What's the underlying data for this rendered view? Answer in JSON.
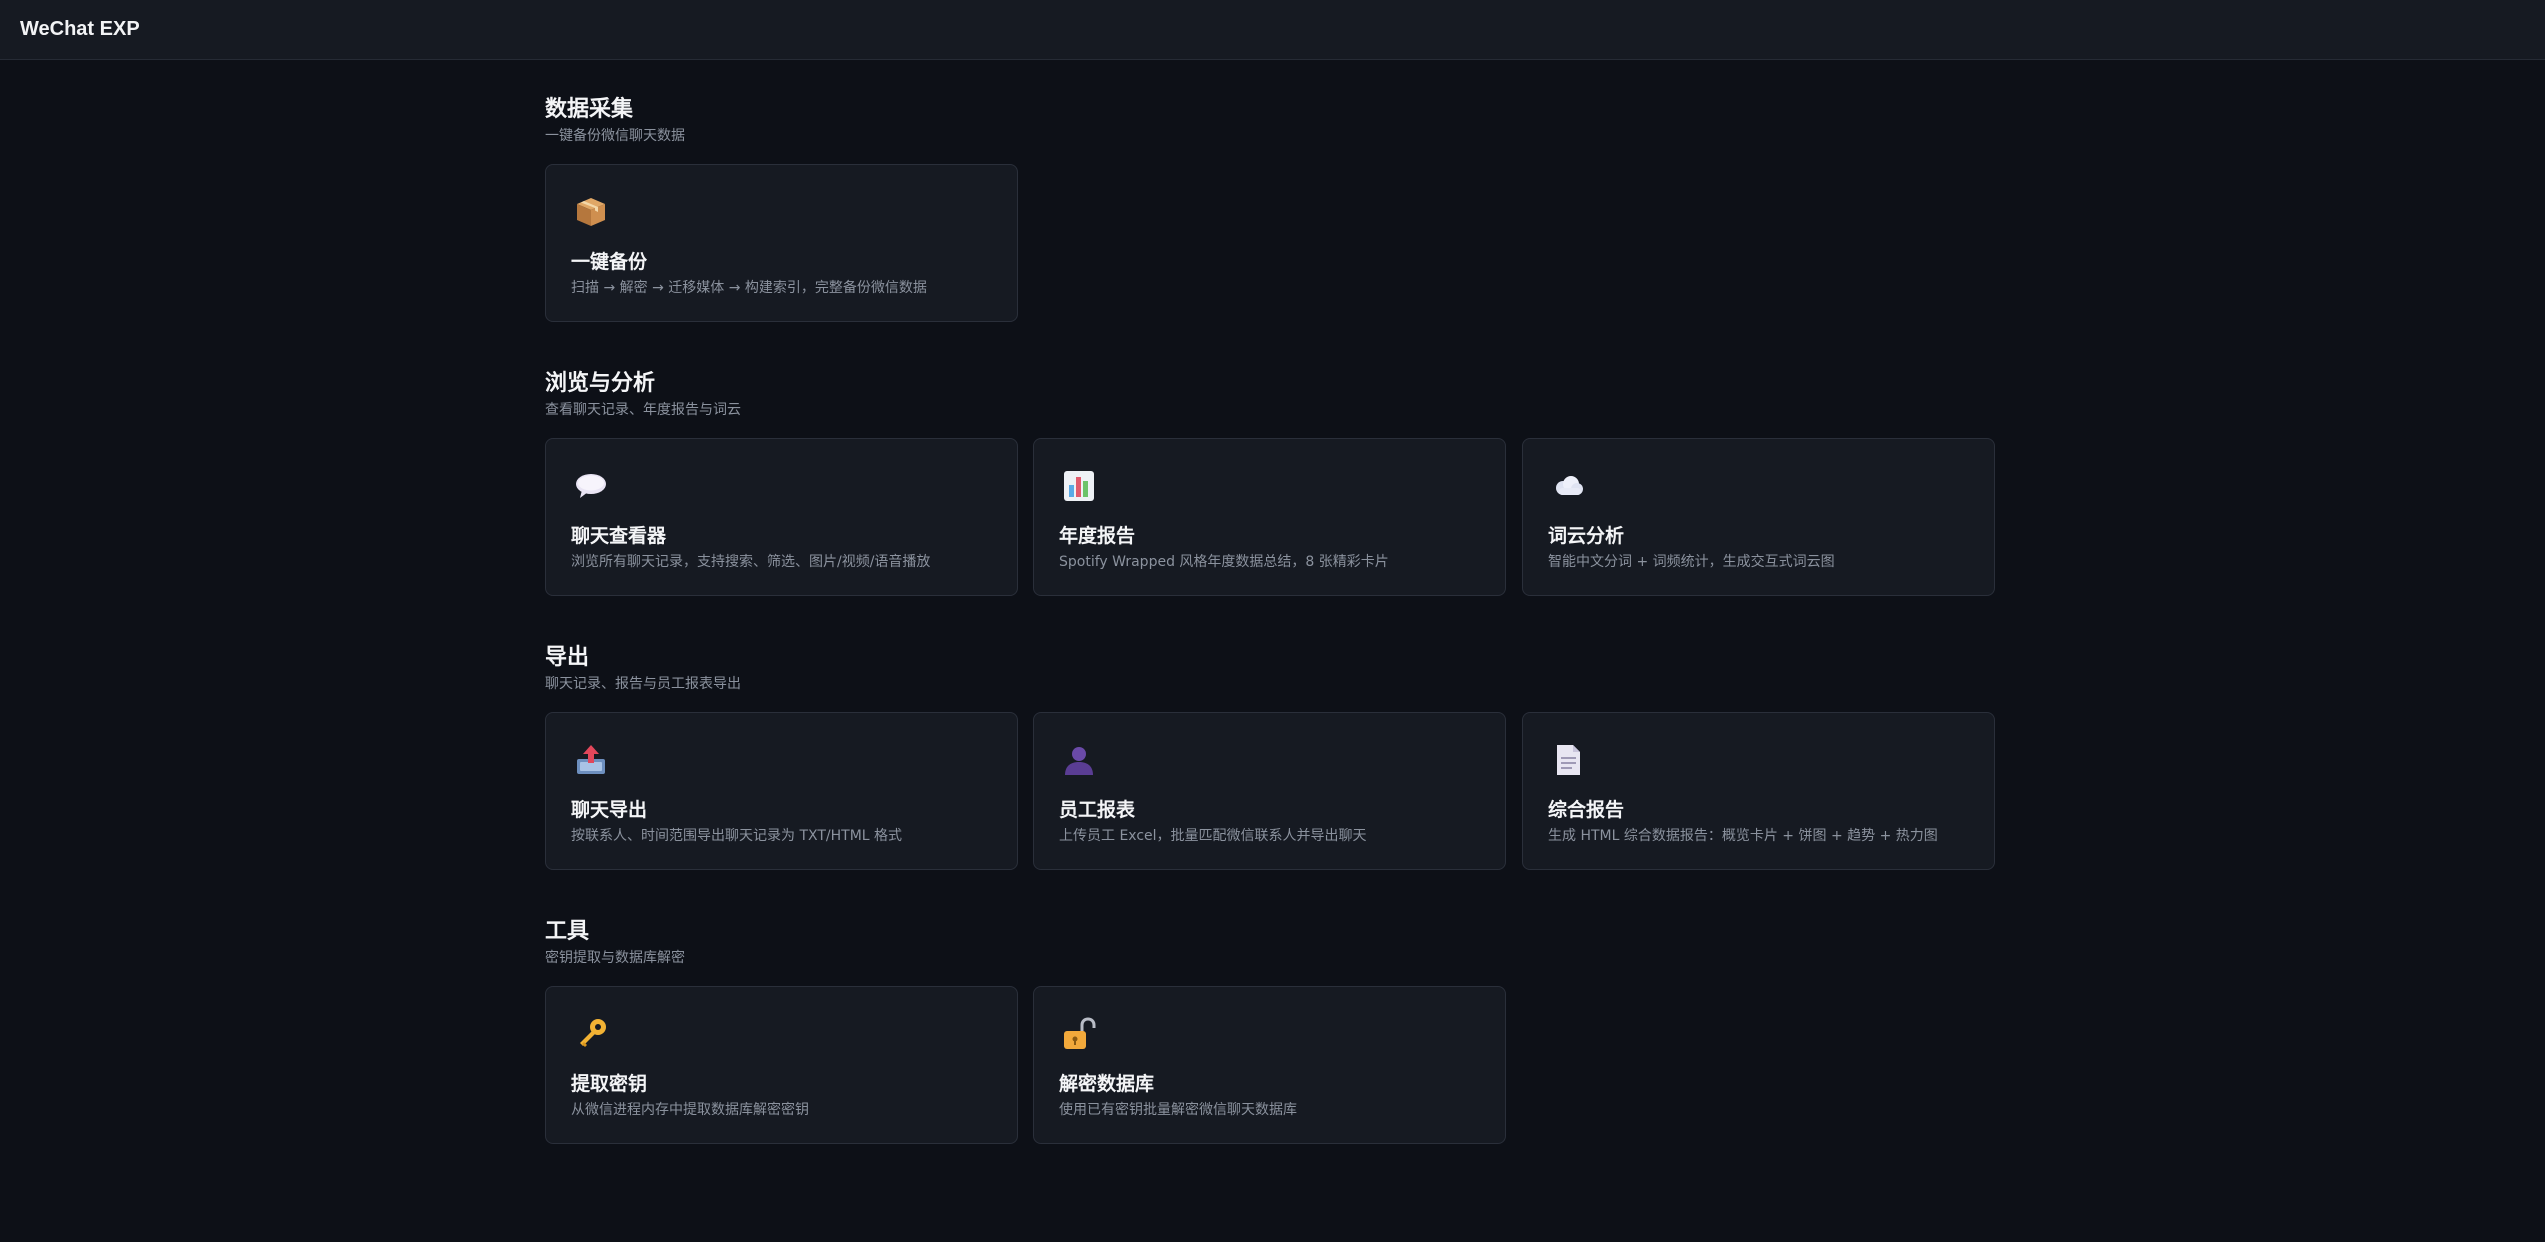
{
  "app": {
    "title": "WeChat EXP"
  },
  "sections": [
    {
      "title": "数据采集",
      "subtitle": "一键备份微信聊天数据",
      "cards": [
        {
          "icon": "package-icon",
          "title": "一键备份",
          "desc": "扫描 → 解密 → 迁移媒体 → 构建索引，完整备份微信数据"
        }
      ]
    },
    {
      "title": "浏览与分析",
      "subtitle": "查看聊天记录、年度报告与词云",
      "cards": [
        {
          "icon": "speech-bubble-icon",
          "title": "聊天查看器",
          "desc": "浏览所有聊天记录，支持搜索、筛选、图片/视频/语音播放"
        },
        {
          "icon": "bar-chart-icon",
          "title": "年度报告",
          "desc": "Spotify Wrapped 风格年度数据总结，8 张精彩卡片"
        },
        {
          "icon": "cloud-icon",
          "title": "词云分析",
          "desc": "智能中文分词 + 词频统计，生成交互式词云图"
        }
      ]
    },
    {
      "title": "导出",
      "subtitle": "聊天记录、报告与员工报表导出",
      "cards": [
        {
          "icon": "outbox-tray-icon",
          "title": "聊天导出",
          "desc": "按联系人、时间范围导出聊天记录为 TXT/HTML 格式"
        },
        {
          "icon": "person-silhouette-icon",
          "title": "员工报表",
          "desc": "上传员工 Excel，批量匹配微信联系人并导出聊天"
        },
        {
          "icon": "document-icon",
          "title": "综合报告",
          "desc": "生成 HTML 综合数据报告：概览卡片 + 饼图 + 趋势 + 热力图"
        }
      ]
    },
    {
      "title": "工具",
      "subtitle": "密钥提取与数据库解密",
      "cards": [
        {
          "icon": "key-icon",
          "title": "提取密钥",
          "desc": "从微信进程内存中提取数据库解密密钥"
        },
        {
          "icon": "unlocked-padlock-icon",
          "title": "解密数据库",
          "desc": "使用已有密钥批量解密微信聊天数据库"
        }
      ]
    }
  ]
}
